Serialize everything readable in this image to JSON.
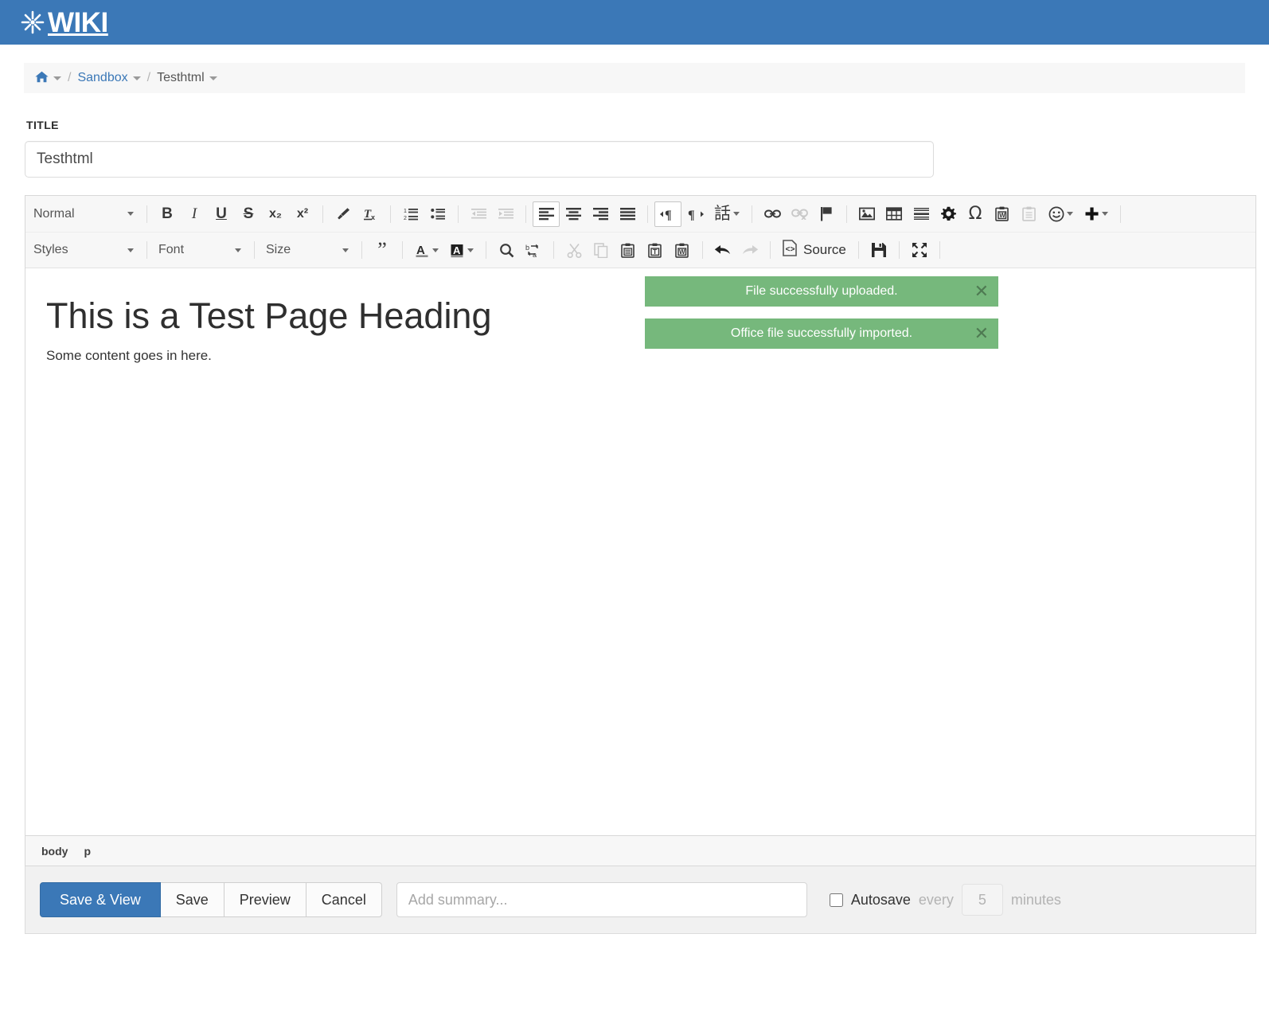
{
  "topbar": {
    "logo_text": "WIKI",
    "logo_icon": "xwiki-star-icon"
  },
  "breadcrumb": {
    "home_icon": "home-icon",
    "separator": "/",
    "items": [
      {
        "label": "Sandbox",
        "type": "link"
      },
      {
        "label": "Testhtml",
        "type": "current"
      }
    ]
  },
  "title": {
    "label": "TITLE",
    "value": "Testhtml",
    "placeholder": ""
  },
  "toolbar": {
    "row1": {
      "format_select": "Normal",
      "buttons": [
        {
          "name": "bold-icon",
          "label": "B"
        },
        {
          "name": "italic-icon",
          "label": "I"
        },
        {
          "name": "underline-icon",
          "label": "U"
        },
        {
          "name": "strikethrough-icon",
          "label": "S"
        },
        {
          "name": "subscript-icon",
          "label": "x₂"
        },
        {
          "name": "superscript-icon",
          "label": "x²"
        },
        {
          "name": "copy-formatting-icon",
          "label": ""
        },
        {
          "name": "remove-format-icon",
          "label": ""
        },
        {
          "name": "numbered-list-icon",
          "label": ""
        },
        {
          "name": "bulleted-list-icon",
          "label": ""
        },
        {
          "name": "decrease-indent-icon",
          "label": ""
        },
        {
          "name": "increase-indent-icon",
          "label": ""
        },
        {
          "name": "align-left-icon",
          "label": ""
        },
        {
          "name": "align-center-icon",
          "label": ""
        },
        {
          "name": "align-right-icon",
          "label": ""
        },
        {
          "name": "justify-icon",
          "label": ""
        },
        {
          "name": "ltr-icon",
          "label": ""
        },
        {
          "name": "rtl-icon",
          "label": ""
        },
        {
          "name": "language-icon",
          "label": "話"
        },
        {
          "name": "link-icon",
          "label": ""
        },
        {
          "name": "unlink-icon",
          "label": ""
        },
        {
          "name": "anchor-flag-icon",
          "label": ""
        },
        {
          "name": "image-icon",
          "label": ""
        },
        {
          "name": "table-icon",
          "label": ""
        },
        {
          "name": "horizontal-rule-icon",
          "label": ""
        },
        {
          "name": "macro-gear-icon",
          "label": ""
        },
        {
          "name": "special-character-icon",
          "label": "Ω"
        },
        {
          "name": "paste-from-word-icon",
          "label": ""
        },
        {
          "name": "paste-icon",
          "label": ""
        },
        {
          "name": "emoticon-icon",
          "label": ""
        },
        {
          "name": "insert-plus-icon",
          "label": ""
        }
      ]
    },
    "row2": {
      "styles_select": "Styles",
      "font_select": "Font",
      "size_select": "Size",
      "source_label": "Source",
      "buttons": [
        {
          "name": "blockquote-icon",
          "label": "”"
        },
        {
          "name": "text-color-icon",
          "label": "A"
        },
        {
          "name": "background-color-icon",
          "label": "A"
        },
        {
          "name": "find-icon",
          "label": ""
        },
        {
          "name": "replace-icon",
          "label": ""
        },
        {
          "name": "cut-icon",
          "label": ""
        },
        {
          "name": "copy-icon",
          "label": ""
        },
        {
          "name": "paste-icon",
          "label": ""
        },
        {
          "name": "paste-as-text-icon",
          "label": "T"
        },
        {
          "name": "paste-from-word-icon",
          "label": "W"
        },
        {
          "name": "undo-icon",
          "label": ""
        },
        {
          "name": "redo-icon",
          "label": ""
        },
        {
          "name": "source-icon",
          "label": ""
        },
        {
          "name": "save-disk-icon",
          "label": ""
        },
        {
          "name": "maximize-icon",
          "label": ""
        }
      ]
    }
  },
  "document": {
    "heading": "This is a Test Page Heading",
    "paragraph": "Some content goes in here."
  },
  "notifications": [
    {
      "message": "File successfully uploaded.",
      "type": "success",
      "close_icon": "close-icon"
    },
    {
      "message": "Office file successfully imported.",
      "type": "success",
      "close_icon": "close-icon"
    }
  ],
  "element_path": {
    "items": [
      "body",
      "p"
    ]
  },
  "footer": {
    "save_and_view_label": "Save & View",
    "save_label": "Save",
    "preview_label": "Preview",
    "cancel_label": "Cancel",
    "summary_placeholder": "Add summary...",
    "summary_value": "",
    "autosave_label": "Autosave",
    "autosave_every": "every",
    "autosave_minutes_value": "5",
    "autosave_minutes_label": "minutes",
    "autosave_checked": false
  },
  "colors": {
    "brand_blue": "#3b78b7",
    "success_green": "#76b87c",
    "toolbar_bg": "#f7f7f7",
    "footer_bg": "#f1f1f1"
  }
}
